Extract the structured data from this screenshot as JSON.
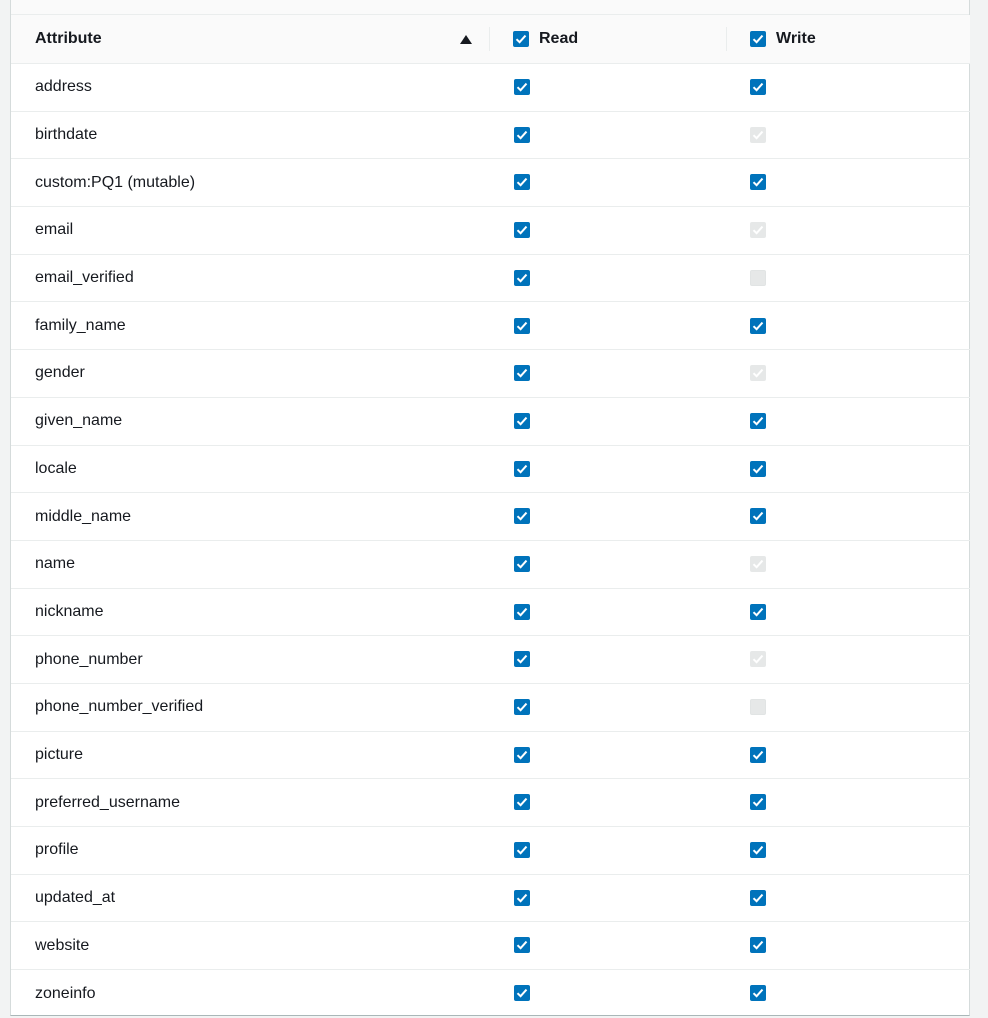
{
  "table": {
    "columns": {
      "attribute": "Attribute",
      "read": "Read",
      "write": "Write"
    },
    "header_read_checked": true,
    "header_write_checked": true,
    "sort": "ascending",
    "rows": [
      {
        "attribute": "address",
        "read": "checked",
        "write": "checked"
      },
      {
        "attribute": "birthdate",
        "read": "checked",
        "write": "checked-disabled"
      },
      {
        "attribute": "custom:PQ1 (mutable)",
        "read": "checked",
        "write": "checked"
      },
      {
        "attribute": "email",
        "read": "checked",
        "write": "checked-disabled"
      },
      {
        "attribute": "email_verified",
        "read": "checked",
        "write": "unchecked-disabled"
      },
      {
        "attribute": "family_name",
        "read": "checked",
        "write": "checked"
      },
      {
        "attribute": "gender",
        "read": "checked",
        "write": "checked-disabled"
      },
      {
        "attribute": "given_name",
        "read": "checked",
        "write": "checked"
      },
      {
        "attribute": "locale",
        "read": "checked",
        "write": "checked"
      },
      {
        "attribute": "middle_name",
        "read": "checked",
        "write": "checked"
      },
      {
        "attribute": "name",
        "read": "checked",
        "write": "checked-disabled"
      },
      {
        "attribute": "nickname",
        "read": "checked",
        "write": "checked"
      },
      {
        "attribute": "phone_number",
        "read": "checked",
        "write": "checked-disabled"
      },
      {
        "attribute": "phone_number_verified",
        "read": "checked",
        "write": "unchecked-disabled"
      },
      {
        "attribute": "picture",
        "read": "checked",
        "write": "checked"
      },
      {
        "attribute": "preferred_username",
        "read": "checked",
        "write": "checked"
      },
      {
        "attribute": "profile",
        "read": "checked",
        "write": "checked"
      },
      {
        "attribute": "updated_at",
        "read": "checked",
        "write": "checked"
      },
      {
        "attribute": "website",
        "read": "checked",
        "write": "checked"
      },
      {
        "attribute": "zoneinfo",
        "read": "checked",
        "write": "checked"
      }
    ]
  },
  "colors": {
    "checkbox_checked": "#0073bb",
    "checkbox_disabled": "#e6e8e8"
  }
}
